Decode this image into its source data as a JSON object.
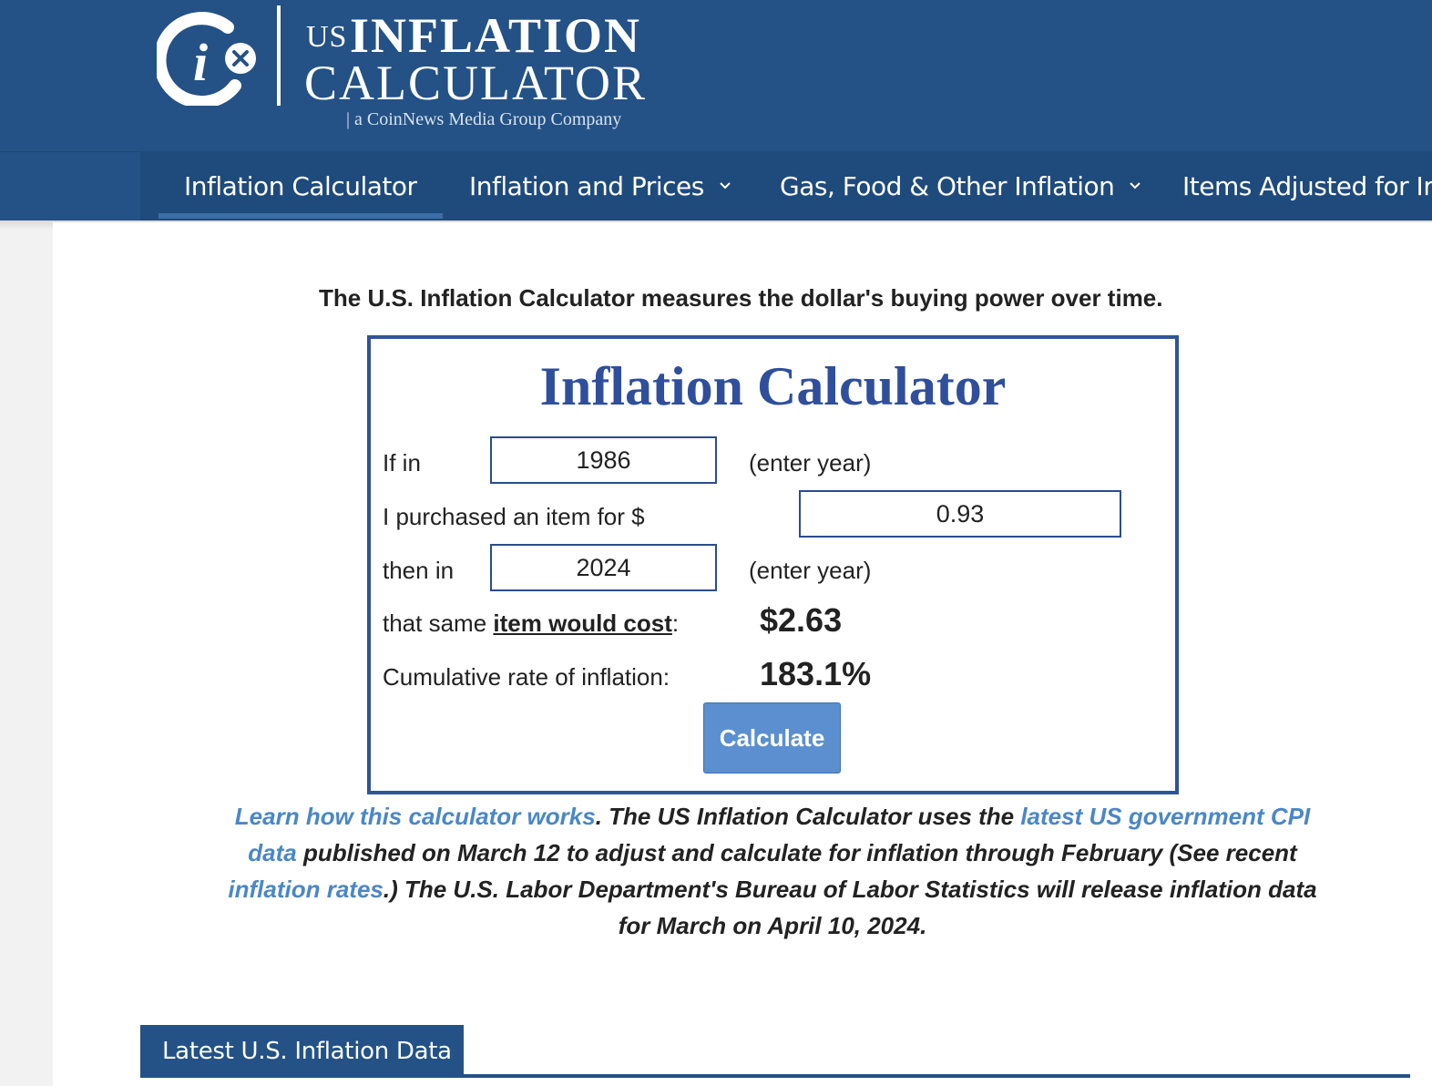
{
  "brand": {
    "logo_us": "US",
    "logo_inflation": "INFLATION",
    "logo_calculator": "CALCULATOR",
    "tagline": "| a CoinNews Media Group Company"
  },
  "nav": {
    "items": [
      {
        "label": "Inflation Calculator",
        "active": true
      },
      {
        "label": "Inflation and Prices",
        "has_dropdown": true
      },
      {
        "label": "Gas, Food & Other Inflation",
        "has_dropdown": true
      },
      {
        "label": "Items Adjusted for Ir"
      }
    ]
  },
  "intro": "The U.S. Inflation Calculator measures the dollar's buying power over time.",
  "calculator": {
    "title": "Inflation Calculator",
    "if_in_label": "If in",
    "start_year": "1986",
    "enter_year_hint": "(enter year)",
    "purchased_label": "I purchased an item for $",
    "amount": "0.93",
    "then_in_label": "then in",
    "end_year": "2024",
    "same_item_prefix": "that same ",
    "same_item_link": "item would cost",
    "same_item_suffix": ":",
    "cost_result": "$2.63",
    "cumulative_label": "Cumulative rate of inflation:",
    "cumulative_result": "183.1%",
    "button_label": "Calculate"
  },
  "description": {
    "link1": "Learn how this calculator works",
    "text1": ". The US Inflation Calculator uses the ",
    "link2": "latest US government CPI data",
    "text2": " published on March 12 to adjust and calculate for inflation through February (See recent ",
    "link3": "inflation rates",
    "text3": ".) The U.S. Labor Department's Bureau of Labor Statistics will release inflation data for March on April 10, 2024."
  },
  "section": {
    "latest_tab": "Latest U.S. Inflation Data"
  },
  "colors": {
    "header_blue": "#245286",
    "title_blue": "#2f4f9c",
    "link_blue": "#4a87c7",
    "button_blue": "#5b8fd0"
  }
}
